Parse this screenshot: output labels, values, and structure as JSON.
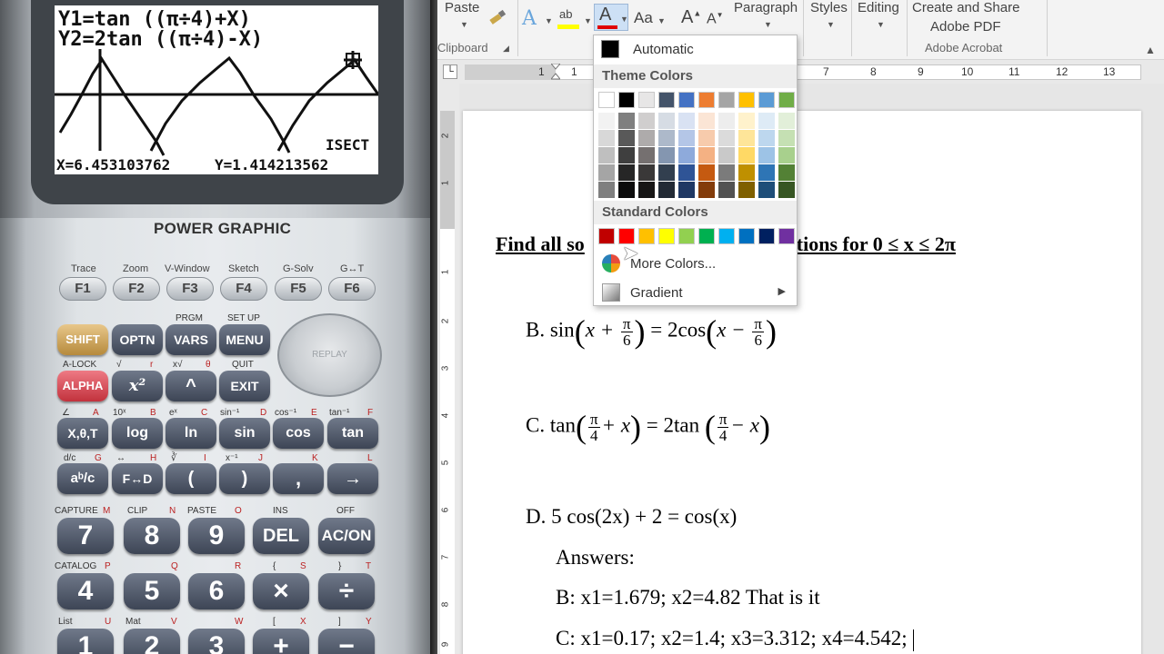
{
  "calculator": {
    "screen": {
      "line1": "Y1=tan ((π÷4)+X)",
      "line2": "Y2=2tan ((π÷4)-X)",
      "mode": "ISECT",
      "x_readout": "X=6.453103762",
      "y_readout": "Y=1.414213562"
    },
    "brand": "POWER GRAPHIC",
    "fkeys": [
      {
        "label": "F1",
        "shift": "Trace"
      },
      {
        "label": "F2",
        "shift": "Zoom"
      },
      {
        "label": "F3",
        "shift": "V-Window"
      },
      {
        "label": "F4",
        "shift": "Sketch"
      },
      {
        "label": "F5",
        "shift": "G-Solv"
      },
      {
        "label": "F6",
        "shift": "G↔T"
      }
    ],
    "row1": [
      "SHIFT",
      "OPTN",
      "VARS",
      "MENU"
    ],
    "row1_labels": [
      "PRGM",
      "SET UP"
    ],
    "row2": [
      "ALPHA",
      "x²",
      "^",
      "EXIT"
    ],
    "row2_labels": [
      "A-LOCK",
      "√",
      "r",
      "x√",
      "θ",
      "QUIT"
    ],
    "row3": [
      "X,θ,T",
      "log",
      "ln",
      "sin",
      "cos",
      "tan"
    ],
    "row3_labels": [
      "∠",
      "A",
      "10ˣ",
      "B",
      "eˣ",
      "C",
      "sin⁻¹",
      "D",
      "cos⁻¹",
      "E",
      "tan⁻¹",
      "F"
    ],
    "row4": [
      "aᵇ/c",
      "F↔D",
      "(",
      ")",
      ",",
      "→"
    ],
    "row4_labels": [
      "d/c",
      "G",
      "↔",
      "H",
      "∛",
      "I",
      "x⁻¹",
      "J",
      "K",
      "L"
    ],
    "row5": [
      "7",
      "8",
      "9",
      "DEL",
      "AC/ON"
    ],
    "row5_labels": [
      "CAPTURE",
      "M",
      "CLIP",
      "N",
      "PASTE",
      "O",
      "INS",
      "OFF"
    ],
    "row6": [
      "4",
      "5",
      "6",
      "×",
      "÷"
    ],
    "row6_labels": [
      "CATALOG",
      "P",
      "Q",
      "R",
      "{",
      "S",
      "}",
      "T"
    ],
    "row7": [
      "1",
      "2",
      "3",
      "+",
      "−"
    ],
    "row7_labels": [
      "List",
      "U",
      "Mat",
      "V",
      "W",
      "[",
      "X",
      "]",
      "Y"
    ],
    "replay": "REPLAY"
  },
  "word": {
    "ribbon": {
      "paste": "Paste",
      "clipboard": "Clipboard",
      "font_size_btn": "Aa",
      "paragraph": "Paragraph",
      "styles": "Styles",
      "editing": "Editing",
      "create_share_1": "Create and Share",
      "create_share_2": "Adobe PDF",
      "adobe_acrobat": "Adobe Acrobat"
    },
    "ruler_numbers": [
      "1",
      "1",
      "7",
      "8",
      "9",
      "10",
      "11",
      "12",
      "13"
    ],
    "vruler_numbers": [
      "2",
      "1",
      "1",
      "2",
      "3",
      "4",
      "5",
      "6",
      "7",
      "8",
      "9"
    ],
    "heading_left": "Find all so",
    "heading_right": "wing equations for 0 ≤ x ≤ 2π",
    "equations": {
      "B": {
        "label": "B.",
        "lhs_fn": "sin",
        "lhs_a": "x +",
        "frac_num": "π",
        "frac_den": "6",
        "eq": "= 2cos",
        "rhs_a": "x −"
      },
      "C": {
        "label": "C.",
        "lhs_fn": "tan",
        "frac_num": "π",
        "frac_den": "4",
        "lhs_b": "+ x",
        "eq": "= 2tan",
        "rhs_b": "− x"
      },
      "D": {
        "label": "D.",
        "text": "5 cos(2x) + 2 = cos(x)"
      }
    },
    "answers_title": "Answers:",
    "answer_b": "B: x1=1.679; x2=4.82 That is it",
    "answer_c": "C: x1=0.17; x2=1.4; x3=3.312; x4=4.542;"
  },
  "color_menu": {
    "automatic": "Automatic",
    "theme_colors_title": "Theme Colors",
    "theme_top": [
      "#ffffff",
      "#000000",
      "#e7e6e6",
      "#44546a",
      "#4472c4",
      "#ed7d31",
      "#a5a5a5",
      "#ffc000",
      "#5b9bd5",
      "#70ad47"
    ],
    "theme_shades": [
      [
        "#f2f2f2",
        "#d8d8d8",
        "#bfbfbf",
        "#a5a5a5",
        "#7f7f7f"
      ],
      [
        "#7f7f7f",
        "#595959",
        "#3f3f3f",
        "#262626",
        "#0c0c0c"
      ],
      [
        "#d0cece",
        "#aeabab",
        "#757070",
        "#3a3838",
        "#171616"
      ],
      [
        "#d6dce4",
        "#adb9ca",
        "#8496b0",
        "#323f4f",
        "#222a35"
      ],
      [
        "#d9e2f3",
        "#b4c6e7",
        "#8eaadb",
        "#2f5496",
        "#1f3864"
      ],
      [
        "#fbe5d5",
        "#f7cbac",
        "#f4b183",
        "#c55a11",
        "#833c0b"
      ],
      [
        "#ededed",
        "#dbdbdb",
        "#c9c9c9",
        "#7b7b7b",
        "#525252"
      ],
      [
        "#fff2cc",
        "#fee599",
        "#ffd965",
        "#bf9000",
        "#7f6000"
      ],
      [
        "#deebf6",
        "#bdd7ee",
        "#9dc3e6",
        "#2e75b5",
        "#1e4e79"
      ],
      [
        "#e2efd9",
        "#c5e0b3",
        "#a8d08d",
        "#538135",
        "#375623"
      ]
    ],
    "standard_colors_title": "Standard Colors",
    "standard": [
      "#c00000",
      "#ff0000",
      "#ffc000",
      "#ffff00",
      "#92d050",
      "#00b050",
      "#00b0f0",
      "#0070c0",
      "#002060",
      "#7030a0"
    ],
    "more_colors": "More Colors...",
    "gradient": "Gradient"
  }
}
